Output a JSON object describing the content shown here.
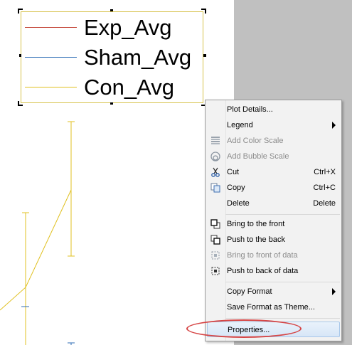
{
  "legend": {
    "entries": [
      {
        "label": "Exp_Avg",
        "color": "#c0392b"
      },
      {
        "label": "Sham_Avg",
        "color": "#2f6db5"
      },
      {
        "label": "Con_Avg",
        "color": "#e0c020"
      }
    ]
  },
  "colors": {
    "con_line": "#e0c020",
    "sham_line": "#2f6db5",
    "highlight": "#d64545"
  },
  "context_menu": {
    "items": {
      "plot_details": "Plot Details...",
      "legend": "Legend",
      "add_color_scale": "Add Color Scale",
      "add_bubble_scale": "Add Bubble Scale",
      "cut": "Cut",
      "cut_shortcut": "Ctrl+X",
      "copy": "Copy",
      "copy_shortcut": "Ctrl+C",
      "delete": "Delete",
      "delete_shortcut": "Delete",
      "bring_front": "Bring to the front",
      "push_back": "Push to the back",
      "bring_front_data": "Bring to front of data",
      "push_back_data": "Push to back of data",
      "copy_format": "Copy Format",
      "save_format": "Save Format as Theme...",
      "properties": "Properties..."
    },
    "icons": {
      "color_scale": "color-scale-icon",
      "bubble_scale": "bubble-scale-icon",
      "cut": "scissors-icon",
      "copy": "copy-icon",
      "bring_front": "bring-front-icon",
      "push_back": "push-back-icon",
      "bring_front_data": "bring-front-data-icon",
      "push_back_data": "push-back-data-icon"
    }
  }
}
